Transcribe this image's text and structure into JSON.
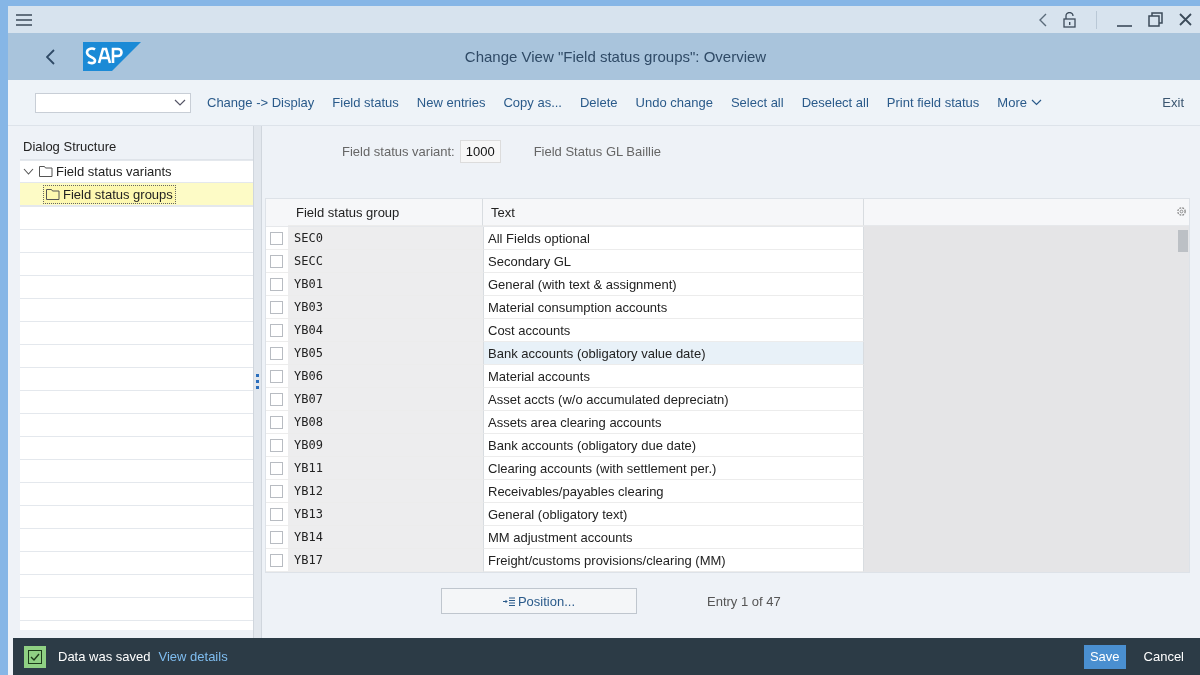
{
  "window": {
    "title": "Change View \"Field status groups\": Overview"
  },
  "toolbar": {
    "actions": [
      "Change -> Display",
      "Field status",
      "New entries",
      "Copy as...",
      "Delete",
      "Undo change",
      "Select all",
      "Deselect all",
      "Print field status"
    ],
    "more": "More",
    "exit": "Exit"
  },
  "dialog_structure": {
    "title": "Dialog Structure",
    "items": [
      {
        "label": "Field status variants",
        "expanded": true,
        "selected": false,
        "children": [
          {
            "label": "Field status groups",
            "selected": true
          }
        ]
      }
    ]
  },
  "variant": {
    "label": "Field status variant:",
    "value": "1000",
    "description": "Field Status GL Baillie"
  },
  "table": {
    "columns": [
      "Field status group",
      "Text"
    ],
    "rows": [
      {
        "group": "SEC0",
        "text": "All Fields optional",
        "checked": false,
        "highlighted": false
      },
      {
        "group": "SECC",
        "text": "Secondary GL",
        "checked": false,
        "highlighted": false
      },
      {
        "group": "YB01",
        "text": "General (with text & assignment)",
        "checked": false,
        "highlighted": false
      },
      {
        "group": "YB03",
        "text": "Material consumption accounts",
        "checked": false,
        "highlighted": false
      },
      {
        "group": "YB04",
        "text": "Cost accounts",
        "checked": false,
        "highlighted": false
      },
      {
        "group": "YB05",
        "text": "Bank accounts (obligatory value date)",
        "checked": false,
        "highlighted": true
      },
      {
        "group": "YB06",
        "text": "Material accounts",
        "checked": false,
        "highlighted": false
      },
      {
        "group": "YB07",
        "text": "Asset accts (w/o accumulated depreciatn)",
        "checked": false,
        "highlighted": false
      },
      {
        "group": "YB08",
        "text": "Assets area clearing accounts",
        "checked": false,
        "highlighted": false
      },
      {
        "group": "YB09",
        "text": "Bank accounts (obligatory due date)",
        "checked": false,
        "highlighted": false
      },
      {
        "group": "YB11",
        "text": "Clearing accounts (with settlement per.)",
        "checked": false,
        "highlighted": false
      },
      {
        "group": "YB12",
        "text": "Receivables/payables clearing",
        "checked": false,
        "highlighted": false
      },
      {
        "group": "YB13",
        "text": "General (obligatory text)",
        "checked": false,
        "highlighted": false
      },
      {
        "group": "YB14",
        "text": "MM adjustment accounts",
        "checked": false,
        "highlighted": false
      },
      {
        "group": "YB17",
        "text": "Freight/customs provisions/clearing (MM)",
        "checked": false,
        "highlighted": false
      }
    ]
  },
  "position_button": "Position...",
  "entry_info": "Entry 1 of 47",
  "status_bar": {
    "message": "Data was saved",
    "link": "View details",
    "buttons": [
      {
        "label": "Save",
        "kind": "primary"
      },
      {
        "label": "Cancel",
        "kind": "plain"
      }
    ]
  }
}
